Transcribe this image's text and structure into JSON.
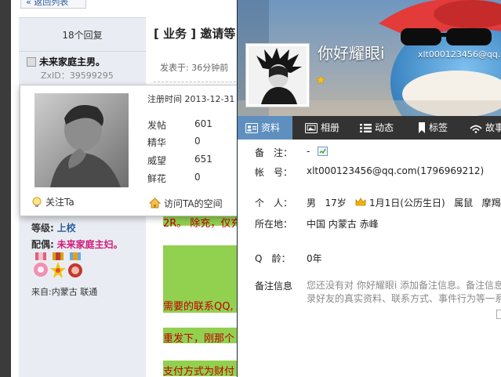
{
  "forum": {
    "back_label": "« 返回列表",
    "replies": "18个回复",
    "thread_title": "[ 业务 ] 邀请等",
    "posted": "发表于: 36分钟前",
    "username": "未来家庭主男。",
    "zxid": "ZxID：39599295",
    "level_label": "等级:",
    "level_value": "上校",
    "spouse_label": "配偶:",
    "spouse_value": "未来家庭主妇。",
    "from": "来自:内蒙古 联通",
    "post_lines": [
      "2R。 除充，仅充",
      "需要的联系QQ,",
      "重发下，刚那个",
      "支付方式为财付"
    ]
  },
  "user_card": {
    "reg_time": "注册时间 2013-12-31",
    "stats": [
      {
        "label": "发帖",
        "value": "601"
      },
      {
        "label": "精华",
        "value": "0"
      },
      {
        "label": "威望",
        "value": "651"
      },
      {
        "label": "鲜花",
        "value": "0"
      }
    ],
    "follow_label": "关注Ta",
    "visit_label": "访问TA的空间"
  },
  "profile": {
    "nickname": "你好耀眼i",
    "account_top": "xlt000123456@qq.",
    "tabs": [
      {
        "label": "资料",
        "icon": "id-card-icon",
        "active": true
      },
      {
        "label": "相册",
        "icon": "photo-icon",
        "active": false
      },
      {
        "label": "动态",
        "icon": "list-icon",
        "active": false
      },
      {
        "label": "标签",
        "icon": "bookmark-icon",
        "active": false
      },
      {
        "label": "故事",
        "icon": "wifi-icon",
        "active": false
      }
    ],
    "fields": {
      "remark_label": "备　注：",
      "remark_value": "-",
      "account_label": "帐　号：",
      "account_value": "xlt000123456@qq.com(1796969212)",
      "personal_label": "个　人：",
      "gender": "男",
      "age": "17岁",
      "birthday": "1月1日(公历生日)",
      "zodiac": "属鼠",
      "sign": "摩羯座",
      "location_label": "所在地：",
      "location_value": "中国 内蒙古 赤峰",
      "qage_label": "Q　龄：",
      "qage_value": "0年",
      "remark_info_label": "备注信息",
      "remark_info_line1": "您还没有对 你好耀眼i 添加备注信息。备注信息",
      "remark_info_line2": "录好友的真实资料、联系方式、事件行为等一系"
    }
  },
  "colors": {
    "tab_active": "#5f8fbf",
    "tab_bar": "#333333",
    "post_highlight": "#92d050",
    "post_text": "#c00000",
    "spouse": "#d2197a",
    "level": "#2a5b9c"
  }
}
